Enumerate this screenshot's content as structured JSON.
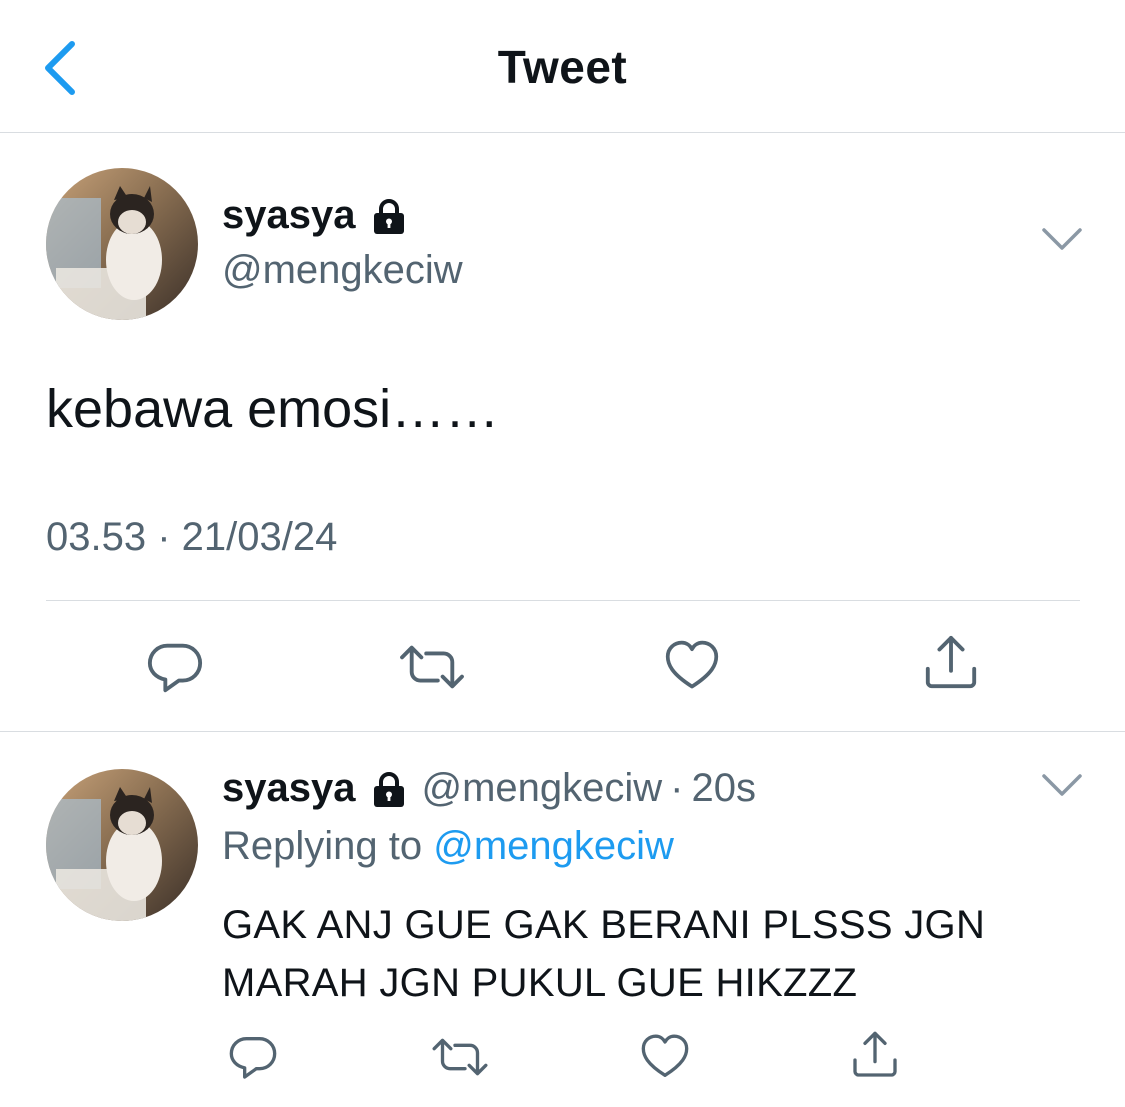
{
  "header": {
    "title": "Tweet",
    "back_icon": "chevron-left-icon"
  },
  "colors": {
    "accent": "#1d9bf0",
    "secondary_text": "#536471",
    "primary_text": "#0f1419",
    "divider": "#d9dde1"
  },
  "main_tweet": {
    "display_name": "syasya",
    "protected_icon": "lock-icon",
    "handle": "@mengkeciw",
    "text": "kebawa emosi……",
    "timestamp": "03.53 · 21/03/24",
    "menu_icon": "chevron-down-icon",
    "actions": [
      "reply-icon",
      "retweet-icon",
      "like-icon",
      "share-icon"
    ]
  },
  "reply_tweet": {
    "display_name": "syasya",
    "protected_icon": "lock-icon",
    "handle": "@mengkeciw",
    "separator": "·",
    "age": "20s",
    "replying_to_label": "Replying to",
    "replying_to_handle": "@mengkeciw",
    "text": "GAK ANJ GUE GAK BERANI PLSSS JGN MARAH JGN PUKUL GUE HIKZZZ",
    "menu_icon": "chevron-down-icon",
    "actions": [
      "reply-icon",
      "retweet-icon",
      "like-icon",
      "share-icon"
    ]
  }
}
